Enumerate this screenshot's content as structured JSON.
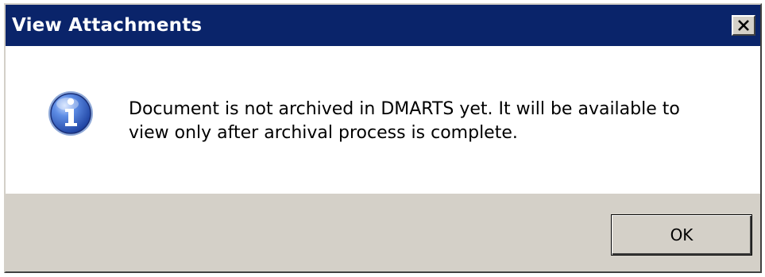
{
  "window": {
    "title": "View Attachments",
    "close_icon": "close-icon"
  },
  "dialog": {
    "icon": "info-icon",
    "message_line1": "Document is not archived in DMARTS yet. It will be available to",
    "message_line2": "view only after archival process is complete.",
    "ok_label": "OK"
  },
  "colors": {
    "titlebar": "#0a246a",
    "face": "#d4d0c8",
    "content_bg": "#ffffff"
  }
}
